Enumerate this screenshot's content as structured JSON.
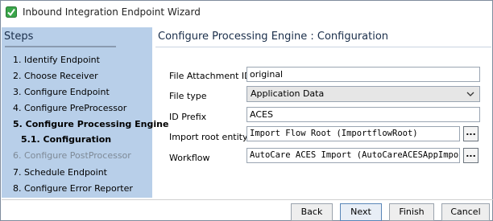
{
  "window": {
    "title": "Inbound Integration Endpoint Wizard"
  },
  "sidebar": {
    "heading": "Steps",
    "steps": [
      {
        "label": "1. Identify Endpoint"
      },
      {
        "label": "2. Choose Receiver"
      },
      {
        "label": "3. Configure Endpoint"
      },
      {
        "label": "4. Configure PreProcessor"
      },
      {
        "label": "5. Configure Processing Engine"
      },
      {
        "label": "5.1. Configuration"
      },
      {
        "label": "6. Configure PostProcessor"
      },
      {
        "label": "7. Schedule Endpoint"
      },
      {
        "label": "8. Configure Error Reporter"
      }
    ]
  },
  "main": {
    "heading": "Configure Processing Engine : Configuration",
    "fields": {
      "file_attachment_id": {
        "label": "File Attachment ID",
        "value": "original"
      },
      "file_type": {
        "label": "File type",
        "value": "Application Data"
      },
      "id_prefix": {
        "label": "ID Prefix",
        "value": "ACES"
      },
      "import_root_entity": {
        "label": "Import root entity",
        "value": "Import Flow Root (ImportflowRoot)",
        "button": "..."
      },
      "workflow": {
        "label": "Workflow",
        "value": "AutoCare ACES Import (AutoCareACESAppImport)",
        "button": "..."
      }
    }
  },
  "footer": {
    "back": "Back",
    "next": "Next",
    "finish": "Finish",
    "cancel": "Cancel"
  },
  "colors": {
    "sidebar_bg": "#b8cfe9",
    "heading_text": "#1a2e4a",
    "icon_green": "#3aa64a"
  }
}
